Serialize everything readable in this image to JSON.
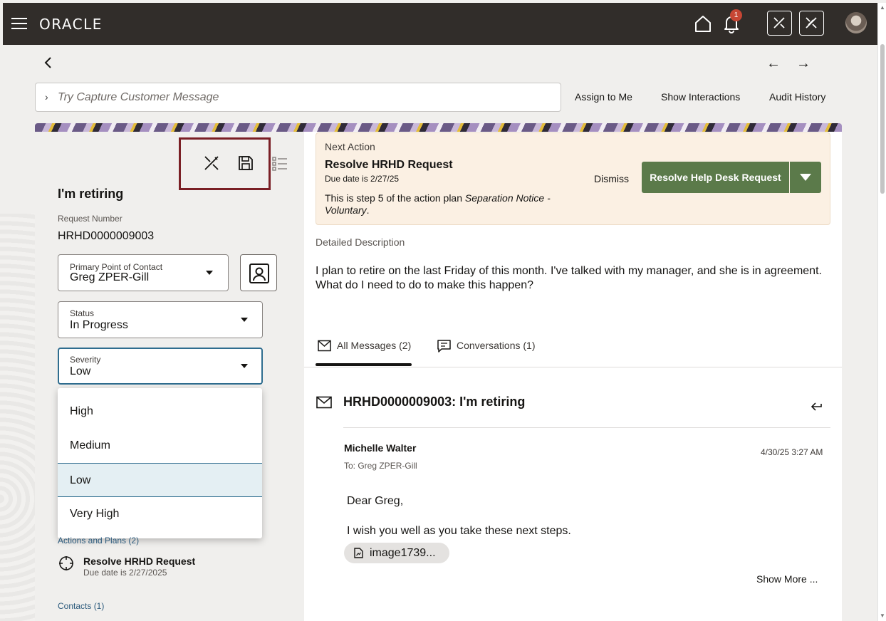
{
  "header": {
    "logo": "ORACLE",
    "notification_count": "1",
    "icons": [
      "hamburger-icon",
      "home-icon",
      "bell-icon",
      "tools-icon",
      "tools-off-icon",
      "avatar"
    ]
  },
  "search": {
    "placeholder": "Try Capture Customer Message"
  },
  "actions": {
    "assign": "Assign to Me",
    "interactions": "Show Interactions",
    "audit": "Audit History"
  },
  "request": {
    "title": "I'm retiring",
    "number_label": "Request Number",
    "number": "HRHD0000009003"
  },
  "fields": {
    "contact_label": "Primary Point of Contact",
    "contact_value": "Greg ZPER-Gill",
    "status_label": "Status",
    "status_value": "In Progress",
    "severity_label": "Severity",
    "severity_value": "Low"
  },
  "severity_options": [
    "High",
    "Medium",
    "Low",
    "Very High"
  ],
  "selected_option": "Low",
  "left_sections": {
    "actions_plans": "Actions and Plans (2)",
    "plan_title": "Resolve HRHD Request",
    "plan_due": "Due date is 2/27/2025",
    "contacts": "Contacts (1)"
  },
  "next_action": {
    "label": "Next Action",
    "title": "Resolve HRHD Request",
    "due": "Due date is 2/27/25",
    "step_prefix": "This is step 5 of the action plan ",
    "step_plan": "Separation Notice - Voluntary",
    "step_suffix": ".",
    "dismiss": "Dismiss",
    "primary_button": "Resolve Help Desk Request"
  },
  "description": {
    "label": "Detailed Description",
    "text": "I plan to retire on the last Friday of this month. I've talked with my manager, and she is in agreement. What do I need to do to make this happen?"
  },
  "tabs": [
    {
      "label": "All Messages (2)",
      "active": true
    },
    {
      "label": "Conversations (1)",
      "active": false
    }
  ],
  "message": {
    "subject": "HRHD0000009003: I'm retiring",
    "sender": "Michelle Walter",
    "to": "To: Greg ZPER-Gill",
    "date": "4/30/25 3:27 AM",
    "greeting": "Dear Greg,",
    "body": "I wish you well as you take these next steps.",
    "attachment": "image1739...",
    "show_more": "Show More ..."
  },
  "colors": {
    "topbar": "#312d2a",
    "accent_green": "#5b7a4a",
    "highlight_border": "#7a1f25",
    "link_blue": "#2c5a7c",
    "badge_red": "#c74634"
  }
}
